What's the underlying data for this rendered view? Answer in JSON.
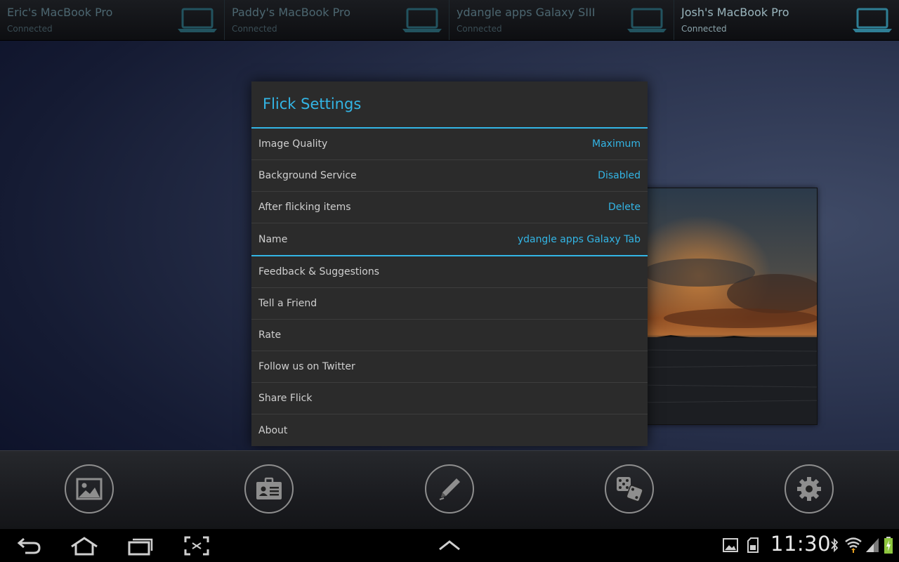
{
  "devices": [
    {
      "name": "Eric's MacBook Pro",
      "status": "Connected",
      "active": false
    },
    {
      "name": "Paddy's MacBook Pro",
      "status": "Connected",
      "active": false
    },
    {
      "name": "ydangle apps Galaxy SIII",
      "status": "Connected",
      "active": false
    },
    {
      "name": "Josh's MacBook Pro",
      "status": "Connected",
      "active": true
    }
  ],
  "dialog": {
    "title": "Flick Settings",
    "settings": [
      {
        "label": "Image Quality",
        "value": "Maximum"
      },
      {
        "label": "Background Service",
        "value": "Disabled"
      },
      {
        "label": "After flicking items",
        "value": "Delete"
      },
      {
        "label": "Name",
        "value": "ydangle apps Galaxy Tab"
      }
    ],
    "links": [
      "Feedback & Suggestions",
      "Tell a Friend",
      "Rate",
      "Follow us on Twitter",
      "Share Flick",
      "About"
    ]
  },
  "actionbar": {
    "buttons": [
      "gallery-icon",
      "contacts-card-icon",
      "pen-icon",
      "dice-icon",
      "gear-icon"
    ]
  },
  "statusbar": {
    "time": "11:30"
  },
  "colors": {
    "accent": "#33b5e5"
  }
}
